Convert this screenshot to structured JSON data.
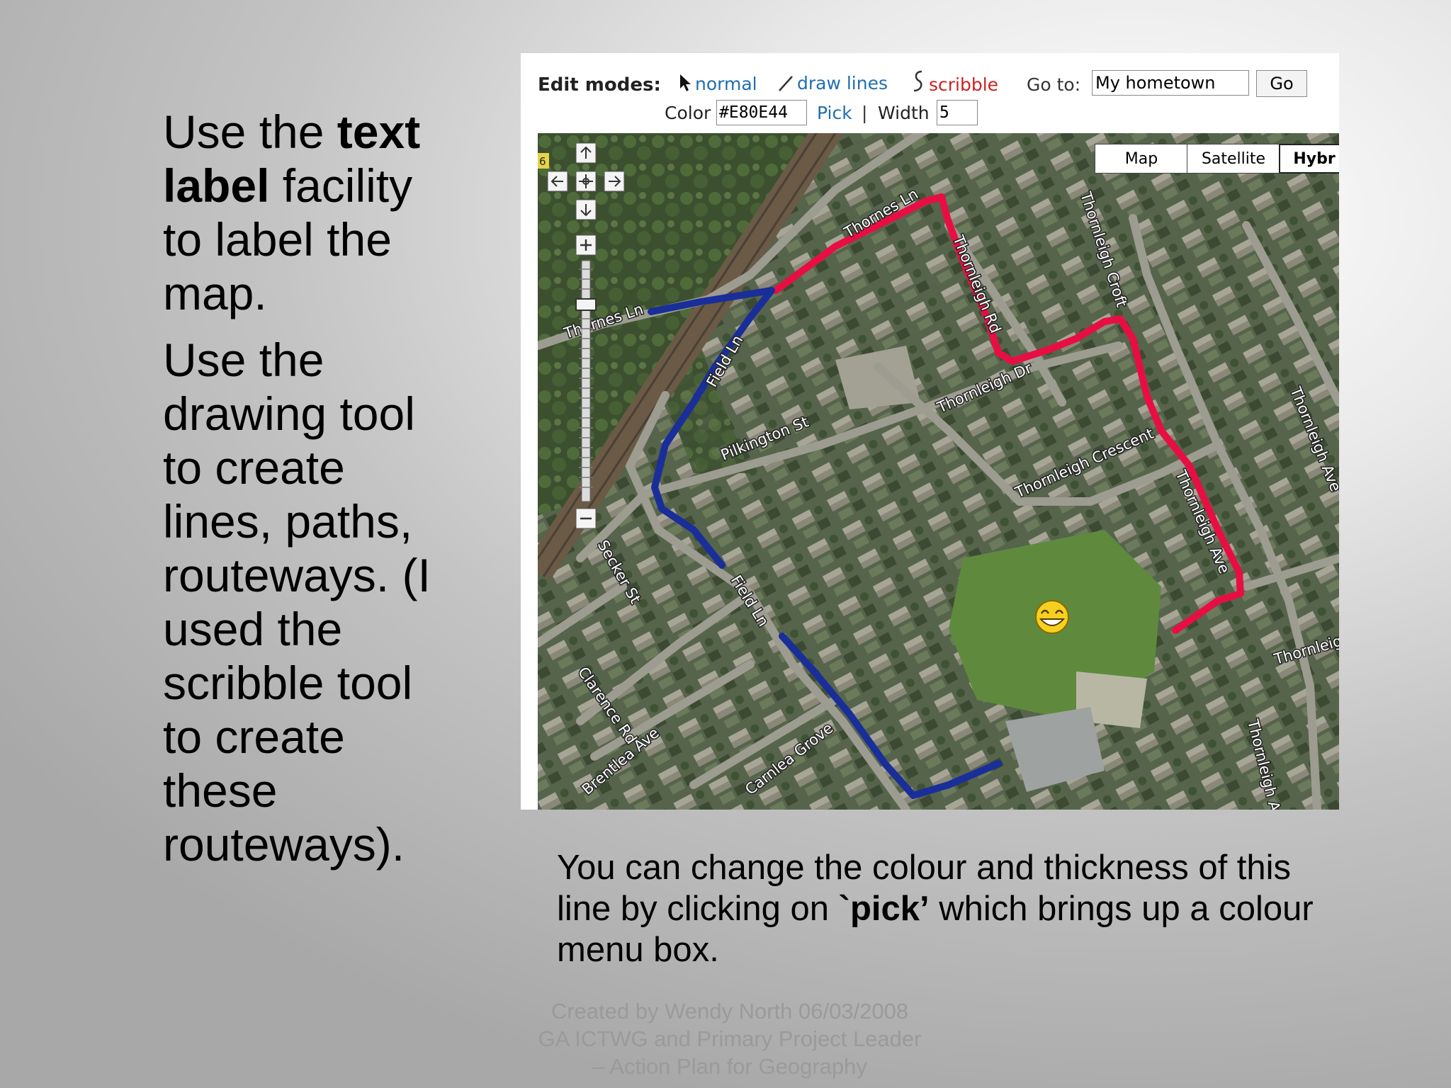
{
  "slide": {
    "para1_pre": "Use the ",
    "para1_bold": "text label",
    "para1_post": " facility to label the map.",
    "para2": "Use the drawing tool to create lines, paths, routeways. (I used the scribble tool to create these routeways).",
    "caption_pre": "You can change the colour and thickness of this line by clicking on ",
    "caption_bold": "`pick’",
    "caption_post": " which brings up a colour menu box.",
    "footer": [
      "Created by Wendy North  06/03/2008",
      "GA ICTWG and Primary Project Leader",
      "– Action Plan for Geography"
    ]
  },
  "toolbar": {
    "edit_modes_label": "Edit modes:",
    "modes": [
      {
        "label": "normal",
        "icon": "arrow-cursor-icon"
      },
      {
        "label": "draw lines",
        "icon": "line-icon"
      },
      {
        "label": "scribble",
        "icon": "scribble-icon"
      }
    ],
    "goto_label": "Go to:",
    "goto_value": "My hometown",
    "go_button": "Go",
    "color_label": "Color",
    "color_value": "#E80E44",
    "pick_label": "Pick",
    "separator": "|",
    "width_label": "Width",
    "width_value": "5"
  },
  "map": {
    "type_buttons": [
      "Map",
      "Satellite",
      "Hybr"
    ],
    "active_type": "Hybr",
    "corner_label": "6",
    "roads": [
      "Thornes Ln",
      "Thornes Ln",
      "Field Ln",
      "Pilkington St",
      "Secker St",
      "Field Ln",
      "Clarence Rd",
      "Brentlea Ave",
      "Carnlea Grove",
      "Thornleigh Rd",
      "Thornleigh Dr",
      "Thornleigh Croft",
      "Thornleigh Crescent",
      "Thornleigh Ave",
      "Thornleigh Ave",
      "Thornleigh",
      "Thornleigh Ave"
    ],
    "route_colors": {
      "red": "#E80E44",
      "blue": "#1a2e9a"
    },
    "marker_icon": "grinning-smiley-icon"
  }
}
